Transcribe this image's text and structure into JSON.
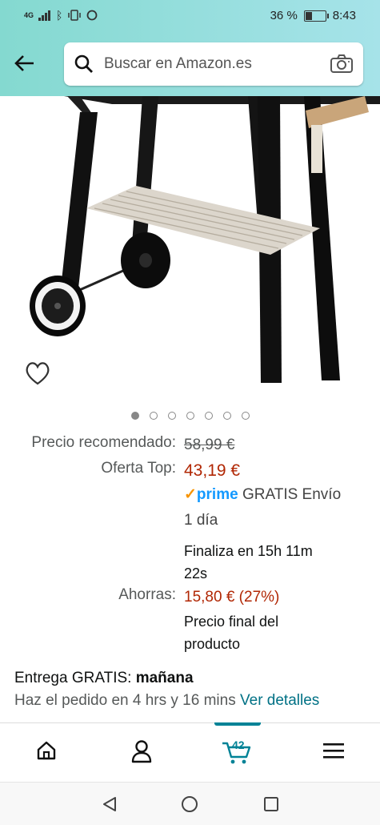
{
  "status_bar": {
    "network": "4G",
    "battery_percent": "36 %",
    "battery_level": 0.36,
    "time": "8:43"
  },
  "header": {
    "back_icon": "arrow-left-icon",
    "search_placeholder": "Buscar en Amazon.es",
    "search_icon": "search-icon",
    "camera_icon": "camera-icon"
  },
  "gallery": {
    "total_images": 7,
    "active_index": 0,
    "wishlist_icon": "heart-icon"
  },
  "pricing": {
    "recommended_label": "Precio recomendado:",
    "recommended_value": "58,99 €",
    "offer_label": "Oferta Top:",
    "offer_value": "43,19 €",
    "prime_label": "prime",
    "shipping_line1": "GRATIS Envío",
    "shipping_line2": "1 día",
    "ends_line1": "Finaliza en 15h 11m",
    "ends_line2": "22s",
    "savings_label": "Ahorras:",
    "savings_value": "15,80 € (27%)",
    "final_line1": "Precio final del",
    "final_line2": "producto"
  },
  "delivery": {
    "prefix": "Entrega GRATIS:",
    "day": "mañana",
    "order_text": "Haz el pedido en 4 hrs y 16 mins",
    "details_link": "Ver detalles"
  },
  "bottom_nav": {
    "items": [
      "home-icon",
      "account-icon",
      "cart-icon",
      "menu-icon"
    ],
    "cart_count": "42",
    "active": "cart"
  },
  "system_nav": [
    "back-triangle-icon",
    "home-circle-icon",
    "recents-square-icon"
  ],
  "colors": {
    "header_start": "#84d9d0",
    "header_end": "#a6e3e9",
    "price_red": "#b12704",
    "link_teal": "#007185",
    "prime_blue": "#1399ff",
    "active_teal": "#008296"
  }
}
